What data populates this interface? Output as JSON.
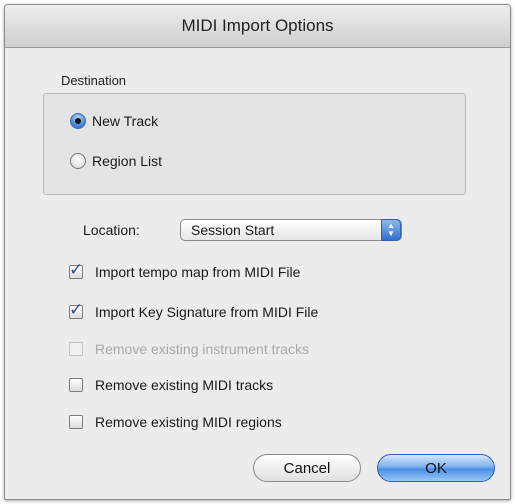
{
  "dialog": {
    "title": "MIDI Import Options"
  },
  "destination": {
    "label": "Destination",
    "options": [
      {
        "label": "New Track",
        "checked": true
      },
      {
        "label": "Region List",
        "checked": false
      }
    ]
  },
  "location": {
    "label": "Location:",
    "selected": "Session Start"
  },
  "checkboxes": [
    {
      "label": "Import tempo map from MIDI File",
      "checked": true,
      "enabled": true
    },
    {
      "label": "Import Key Signature from MIDI File",
      "checked": true,
      "enabled": true
    },
    {
      "label": "Remove existing instrument tracks",
      "checked": false,
      "enabled": false
    },
    {
      "label": "Remove existing MIDI tracks",
      "checked": false,
      "enabled": true
    },
    {
      "label": "Remove existing MIDI regions",
      "checked": false,
      "enabled": true
    }
  ],
  "buttons": {
    "cancel": "Cancel",
    "ok": "OK"
  },
  "colors": {
    "accent": "#3a7bd5",
    "window_bg": "#ececec",
    "disabled_text": "#a8a8a8"
  },
  "icons": {
    "checkmark": "checkmark-icon",
    "select_arrows": "updown-arrows-icon"
  }
}
